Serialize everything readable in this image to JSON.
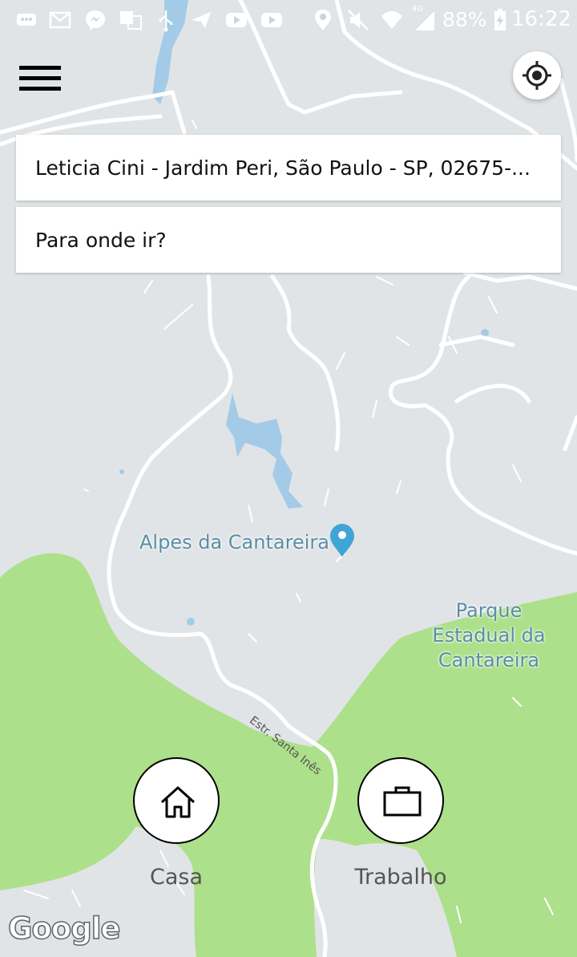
{
  "status_bar": {
    "battery_percent": "88%",
    "network": "4G",
    "time": "16:22"
  },
  "search": {
    "origin": "Leticia Cini - Jardim Peri, São Paulo - SP, 02675-...",
    "destination_placeholder": "Para onde ir?"
  },
  "map": {
    "place_label": "Alpes da Cantareira",
    "park_label_line1": "Parque",
    "park_label_line2": "Estadual da",
    "park_label_line3": "Cantareira",
    "road_label": "Estr. Santa Inês",
    "attribution": "Google"
  },
  "shortcuts": {
    "home_label": "Casa",
    "work_label": "Trabalho"
  },
  "colors": {
    "map_background": "#e1e4e6",
    "park_green": "#ade08a",
    "water_blue": "#a3cbe8",
    "road_white": "#ffffff",
    "pin_blue": "#3fa4d6"
  },
  "icons": {
    "menu": "hamburger-icon",
    "locate": "my-location-icon",
    "home": "home-icon",
    "work": "briefcase-icon",
    "pin": "map-pin-icon"
  }
}
